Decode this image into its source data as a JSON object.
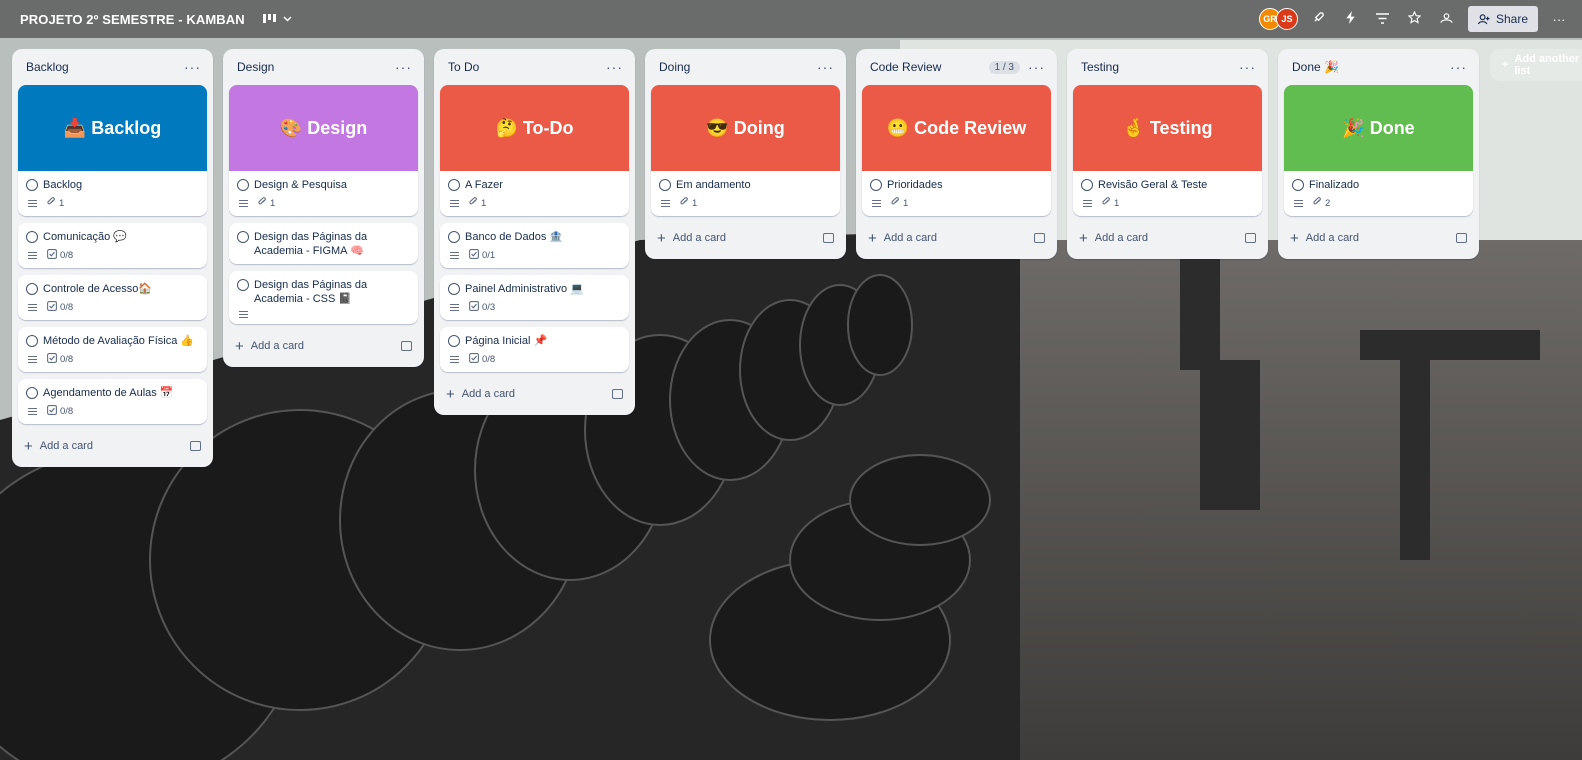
{
  "board": {
    "title": "PROJETO 2º SEMESTRE - KAMBAN",
    "view_icon": "board-view-icon",
    "share_label": "Share",
    "members": [
      {
        "initials": "GR",
        "color": "#f18a00"
      },
      {
        "initials": "JS",
        "color": "#d93a1a"
      }
    ]
  },
  "lists": [
    {
      "title": "Backlog",
      "cover": {
        "label": "📥 Backlog",
        "color": "#0079bf"
      },
      "cards": [
        {
          "title": "Backlog",
          "badges": [
            {
              "icon": "description-icon",
              "text": ""
            },
            {
              "icon": "attachment-icon",
              "text": "1"
            }
          ]
        },
        {
          "title": "Comunicação 💬",
          "badges": [
            {
              "icon": "description-icon",
              "text": ""
            },
            {
              "icon": "checklist-icon",
              "text": "0/8"
            }
          ]
        },
        {
          "title": "Controle de Acesso🏠",
          "badges": [
            {
              "icon": "description-icon",
              "text": ""
            },
            {
              "icon": "checklist-icon",
              "text": "0/8"
            }
          ]
        },
        {
          "title": "Método de Avaliação Física 👍",
          "badges": [
            {
              "icon": "description-icon",
              "text": ""
            },
            {
              "icon": "checklist-icon",
              "text": "0/8"
            }
          ]
        },
        {
          "title": "Agendamento de Aulas 📅",
          "badges": [
            {
              "icon": "description-icon",
              "text": ""
            },
            {
              "icon": "checklist-icon",
              "text": "0/8"
            }
          ]
        }
      ],
      "add_label": "Add a card"
    },
    {
      "title": "Design",
      "cover": {
        "label": "🎨 Design",
        "color": "#c377e0"
      },
      "cards": [
        {
          "title": "Design & Pesquisa",
          "badges": [
            {
              "icon": "description-icon",
              "text": ""
            },
            {
              "icon": "attachment-icon",
              "text": "1"
            }
          ]
        },
        {
          "title": "Design das Páginas da Academia - FIGMA 🧠",
          "badges": []
        },
        {
          "title": "Design das Páginas da Academia - CSS 📓",
          "badges": [
            {
              "icon": "description-icon",
              "text": ""
            }
          ]
        }
      ],
      "add_label": "Add a card"
    },
    {
      "title": "To Do",
      "cover": {
        "label": "🤔 To-Do",
        "color": "#eb5a46"
      },
      "cards": [
        {
          "title": "A Fazer",
          "badges": [
            {
              "icon": "description-icon",
              "text": ""
            },
            {
              "icon": "attachment-icon",
              "text": "1"
            }
          ]
        },
        {
          "title": "Banco de Dados 🏦",
          "badges": [
            {
              "icon": "description-icon",
              "text": ""
            },
            {
              "icon": "checklist-icon",
              "text": "0/1"
            }
          ]
        },
        {
          "title": "Painel Administrativo 💻",
          "badges": [
            {
              "icon": "description-icon",
              "text": ""
            },
            {
              "icon": "checklist-icon",
              "text": "0/3"
            }
          ]
        },
        {
          "title": "Página Inicial 📌",
          "badges": [
            {
              "icon": "description-icon",
              "text": ""
            },
            {
              "icon": "checklist-icon",
              "text": "0/8"
            }
          ]
        }
      ],
      "add_label": "Add a card"
    },
    {
      "title": "Doing",
      "cover": {
        "label": "😎 Doing",
        "color": "#eb5a46"
      },
      "cards": [
        {
          "title": "Em andamento",
          "badges": [
            {
              "icon": "description-icon",
              "text": ""
            },
            {
              "icon": "attachment-icon",
              "text": "1"
            }
          ]
        }
      ],
      "add_label": "Add a card"
    },
    {
      "title": "Code Review",
      "count": "1 / 3",
      "cover": {
        "label": "😬 Code Review",
        "color": "#eb5a46"
      },
      "cards": [
        {
          "title": "Prioridades",
          "badges": [
            {
              "icon": "description-icon",
              "text": ""
            },
            {
              "icon": "attachment-icon",
              "text": "1"
            }
          ]
        }
      ],
      "add_label": "Add a card"
    },
    {
      "title": "Testing",
      "cover": {
        "label": "🤞 Testing",
        "color": "#eb5a46"
      },
      "cards": [
        {
          "title": "Revisão Geral & Teste",
          "badges": [
            {
              "icon": "description-icon",
              "text": ""
            },
            {
              "icon": "attachment-icon",
              "text": "1"
            }
          ]
        }
      ],
      "add_label": "Add a card"
    },
    {
      "title": "Done 🎉",
      "cover": {
        "label": "🎉 Done",
        "color": "#61bd4f"
      },
      "cards": [
        {
          "title": "Finalizado",
          "badges": [
            {
              "icon": "description-icon",
              "text": ""
            },
            {
              "icon": "attachment-icon",
              "text": "2"
            }
          ]
        }
      ],
      "add_label": "Add a card"
    }
  ],
  "add_list_label": "Add another list"
}
